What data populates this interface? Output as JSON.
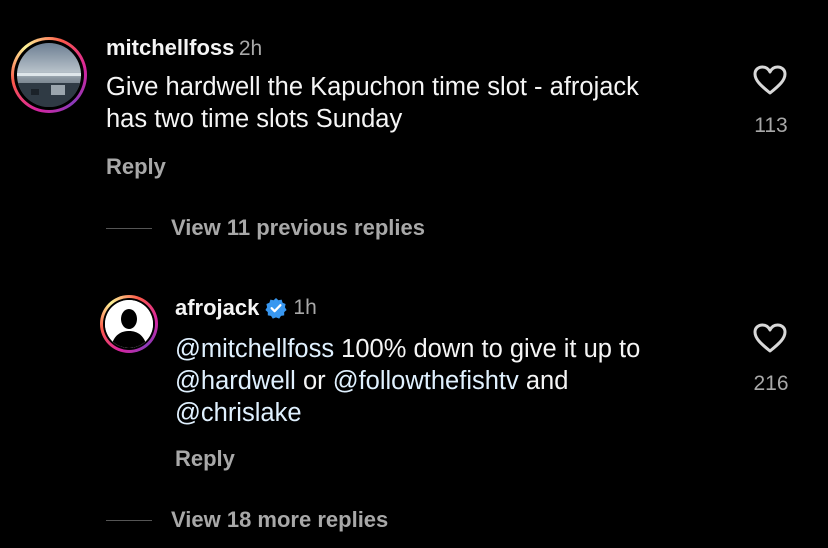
{
  "comment": {
    "username": "mitchellfoss",
    "time": "2h",
    "text_line1": "Give hardwell the Kapuchon time slot - afrojack",
    "text_line2": "has two time slots Sunday",
    "like_count": "113",
    "reply_label": "Reply"
  },
  "view_previous": "View 11 previous replies",
  "reply": {
    "username": "afrojack",
    "verified_icon": "verified-badge-icon",
    "time": "1h",
    "mention1": "@mitchellfoss",
    "text1": " 100% down to give it up to",
    "mention2": "@hardwell",
    "text2": " or ",
    "mention3": "@followthefishtv",
    "text3": " and",
    "mention4": "@chrislake",
    "like_count": "216",
    "reply_label": "Reply"
  },
  "view_more": "View 18 more replies",
  "colors": {
    "background": "#000000",
    "primary_text": "#f5f5f5",
    "secondary_text": "#a8a8a8",
    "mention": "#e0f1ff",
    "verified": "#3897f0"
  }
}
